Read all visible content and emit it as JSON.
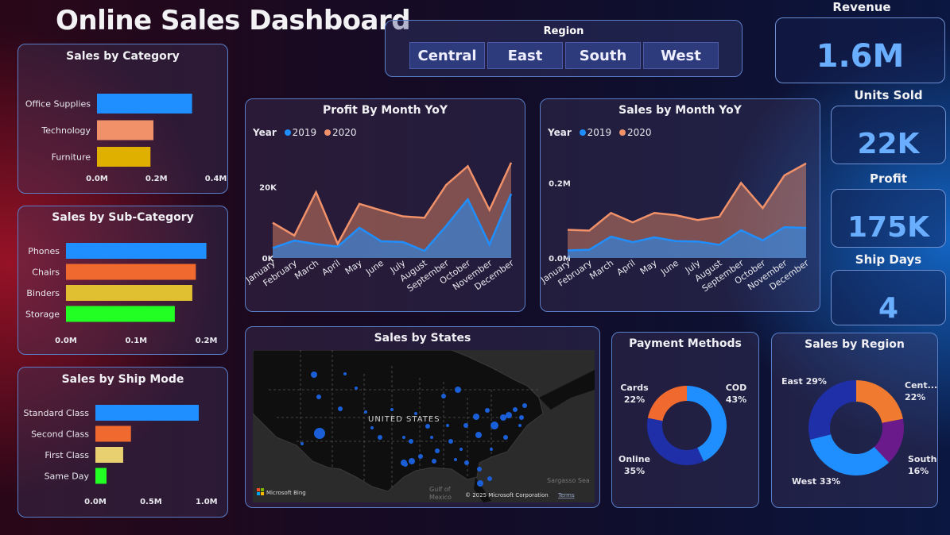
{
  "title": "Online Sales Dashboard",
  "region_slicer": {
    "title": "Region",
    "options": [
      "Central",
      "East",
      "South",
      "West"
    ]
  },
  "kpis": {
    "revenue": {
      "label": "Revenue",
      "value": "1.6M"
    },
    "units": {
      "label": "Units Sold",
      "value": "22K"
    },
    "profit": {
      "label": "Profit",
      "value": "175K"
    },
    "ship_days": {
      "label": "Ship Days",
      "value": "4"
    }
  },
  "colors": {
    "blue": "#1f8fff",
    "orange": "#f0916a",
    "gold": "#e0b000",
    "green": "#22ff22",
    "navy": "#1f2fa8",
    "purple": "#6a1a8a"
  },
  "legend": {
    "label": "Year",
    "y2019": "2019",
    "y2020": "2020"
  },
  "chart_data": [
    {
      "type": "bar",
      "title": "Sales by Category",
      "categories": [
        "Office Supplies",
        "Technology",
        "Furniture"
      ],
      "values": [
        0.32,
        0.19,
        0.18
      ],
      "ticks": [
        "0.0M",
        "0.2M",
        "0.4M"
      ],
      "xlim": [
        0,
        0.42
      ]
    },
    {
      "type": "bar",
      "title": "Sales by Sub-Category",
      "categories": [
        "Phones",
        "Chairs",
        "Binders",
        "Storage"
      ],
      "values": [
        0.2,
        0.185,
        0.18,
        0.155
      ],
      "ticks": [
        "0.0M",
        "0.1M",
        "0.2M"
      ],
      "xlim": [
        0,
        0.205
      ]
    },
    {
      "type": "bar",
      "title": "Sales by Ship Mode",
      "categories": [
        "Standard Class",
        "Second Class",
        "First Class",
        "Same Day"
      ],
      "values": [
        0.93,
        0.32,
        0.25,
        0.1
      ],
      "ticks": [
        "0.0M",
        "0.5M",
        "1.0M"
      ],
      "xlim": [
        0,
        1.03
      ]
    },
    {
      "type": "area",
      "title": "Profit By Month YoY",
      "x": [
        "January",
        "February",
        "March",
        "April",
        "May",
        "June",
        "July",
        "August",
        "September",
        "October",
        "November",
        "December"
      ],
      "series": [
        {
          "name": "2019",
          "values": [
            2800,
            4900,
            3900,
            3200,
            8500,
            4700,
            4500,
            2000,
            9000,
            16500,
            3800,
            18000
          ]
        },
        {
          "name": "2020",
          "values": [
            9900,
            6300,
            18500,
            4000,
            15200,
            13400,
            11700,
            11300,
            20500,
            25800,
            13500,
            26800
          ]
        }
      ],
      "ticks": [
        "0K",
        "20K"
      ],
      "ylim": [
        0,
        29000
      ]
    },
    {
      "type": "area",
      "title": "Sales by Month YoY",
      "x": [
        "January",
        "February",
        "March",
        "April",
        "May",
        "June",
        "July",
        "August",
        "September",
        "October",
        "November",
        "December"
      ],
      "series": [
        {
          "name": "2019",
          "values": [
            0.02,
            0.022,
            0.057,
            0.042,
            0.055,
            0.045,
            0.044,
            0.035,
            0.074,
            0.047,
            0.082,
            0.08
          ]
        },
        {
          "name": "2020",
          "values": [
            0.075,
            0.073,
            0.12,
            0.095,
            0.12,
            0.114,
            0.101,
            0.11,
            0.2,
            0.133,
            0.22,
            0.252
          ]
        }
      ],
      "ticks": [
        "0.0M",
        "0.2M"
      ],
      "ylim": [
        0,
        0.275
      ]
    },
    {
      "type": "pie",
      "title": "Payment Methods",
      "slices": [
        {
          "name": "COD",
          "value": 43,
          "label": "43%"
        },
        {
          "name": "Online",
          "value": 35,
          "label": "35%"
        },
        {
          "name": "Cards",
          "value": 22,
          "label": "22%"
        }
      ]
    },
    {
      "type": "pie",
      "title": "Sales by Region",
      "slices": [
        {
          "name": "Cent...",
          "value": 22,
          "label": "22%"
        },
        {
          "name": "South",
          "value": 16,
          "label": "16%"
        },
        {
          "name": "West",
          "value": 33,
          "label": "33%"
        },
        {
          "name": "East",
          "value": 29,
          "label": "29%"
        }
      ]
    }
  ],
  "map": {
    "title": "Sales by States",
    "country_label": "UNITED STATES",
    "sea_label_1": "Gulf of",
    "sea_label_2": "Mexico",
    "sea_label_3": "Sargasso Sea",
    "bing": "Microsoft Bing",
    "copyright": "© 2025 Microsoft Corporation",
    "terms": "Terms"
  }
}
